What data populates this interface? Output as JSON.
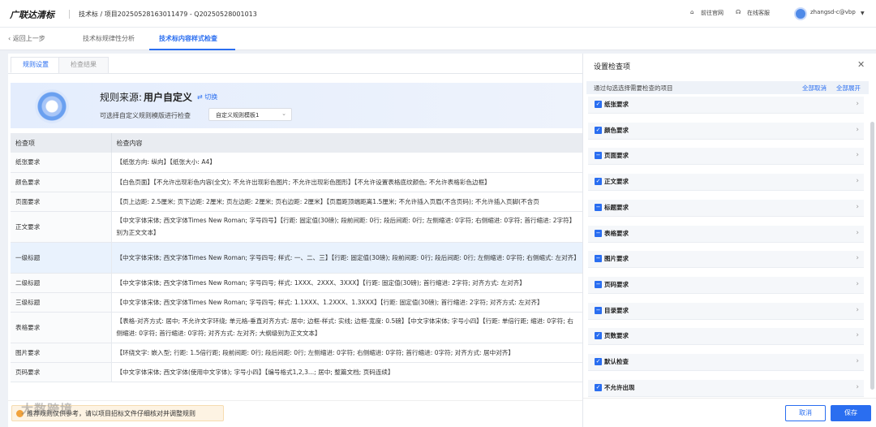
{
  "header": {
    "logo": "广联达清标",
    "breadcrumb": "技术标 / 项目20250528163011479 - Q20250528001013",
    "official_site": "前往官网",
    "support": "在线客服",
    "user": "zhangsd-c@vbp"
  },
  "nav": {
    "back": "返回上一步",
    "tab1": "技术标规律性分析",
    "tab2": "技术标内容样式检查"
  },
  "subtabs": [
    "规则设置",
    "检查结果"
  ],
  "banner": {
    "source_label": "规则来源:",
    "source_value": "用户自定义",
    "switch": "切换",
    "hint": "可选择自定义规则模版进行检查",
    "template": "自定义规则模板1"
  },
  "table": {
    "headers": [
      "检查项",
      "检查内容"
    ],
    "rows": [
      {
        "name": "纸张要求",
        "content": "【纸张方向: 纵向】【纸张大小: A4】"
      },
      {
        "name": "颜色要求",
        "content": "【白色页面】【不允许出现彩色内容(全文); 不允许出现彩色图片; 不允许出现彩色图形】【不允许设置表格底纹颜色; 不允许表格彩色边框】"
      },
      {
        "name": "页面要求",
        "content": "【页上边距: 2.5厘米; 页下边距: 2厘米; 页左边距: 2厘米; 页右边距: 2厘米】【页眉距顶端距离1.5厘米; 不允许插入页眉(不含页码); 不允许插入页脚(不含页"
      },
      {
        "name": "正文要求",
        "content": "【中文字体宋体; 西文字体Times New Roman; 字号四号】【行距: 固定值(30磅); 段前间距: 0行; 段后间距: 0行; 左侧缩进: 0字符; 右侧缩进: 0字符; 首行缩进: 2字符】别为正文文本】"
      },
      {
        "name": "一级标题",
        "content": "【中文字体宋体; 西文字体Times New Roman; 字号四号; 样式: 一、二、三】【行距: 固定值(30磅); 段前间距: 0行; 段后间距: 0行; 左侧缩进: 0字符; 右侧缩式: 左对齐】"
      },
      {
        "name": "二级标题",
        "content": "【中文字体宋体; 西文字体Times New Roman; 字号四号; 样式: 1XXX、2XXX、3XXX】【行距: 固定值(30磅); 首行缩进: 2字符; 对齐方式: 左对齐】"
      },
      {
        "name": "三级标题",
        "content": "【中文字体宋体; 西文字体Times New Roman; 字号四号; 样式: 1.1XXX、1.2XXX、1.3XXX】【行距: 固定值(30磅); 首行缩进: 2字符; 对齐方式: 左对齐】"
      },
      {
        "name": "表格要求",
        "content": "【表格-对齐方式: 居中; 不允许文字环绕; 单元格-垂直对齐方式: 居中; 边框-样式: 实线; 边框-宽度: 0.5磅】【中文字体宋体; 字号小四】【行距: 单倍行距; 缩进: 0字符; 右侧缩进: 0字符; 首行缩进: 0字符; 对齐方式: 左对齐; 大纲级别为正文文本】"
      },
      {
        "name": "图片要求",
        "content": "【环绕文字: 嵌入型; 行距: 1.5倍行距; 段前间距: 0行; 段后间距: 0行; 左侧缩进: 0字符; 右侧缩进: 0字符; 首行缩进: 0字符; 对齐方式: 居中对齐】"
      },
      {
        "name": "页码要求",
        "content": "【中文字体宋体; 西文字体(使用中文字体); 字号小四】【编号格式1,2,3...; 居中; 整篇文档; 页码连续】"
      }
    ]
  },
  "footer_tip": "推荐规则仅供参考，请以项目招标文件仔细核对并调整规则",
  "watermark": "大数跨境",
  "panel": {
    "title": "设置检查项",
    "subtitle": "通过勾选选择需要检查的项目",
    "clear_all": "全部取消",
    "expand_all": "全部展开",
    "items": [
      {
        "label": "纸张要求",
        "state": "✓"
      },
      {
        "label": "颜色要求",
        "state": "✓"
      },
      {
        "label": "页面要求",
        "state": "−"
      },
      {
        "label": "正文要求",
        "state": "✓"
      },
      {
        "label": "标题要求",
        "state": "−"
      },
      {
        "label": "表格要求",
        "state": "−"
      },
      {
        "label": "图片要求",
        "state": "−"
      },
      {
        "label": "页码要求",
        "state": "−"
      },
      {
        "label": "目录要求",
        "state": "−"
      },
      {
        "label": "页数要求",
        "state": "✓"
      },
      {
        "label": "默认检查",
        "state": "✓"
      },
      {
        "label": "不允许出现",
        "state": "✓"
      }
    ],
    "cancel": "取消",
    "save": "保存"
  }
}
